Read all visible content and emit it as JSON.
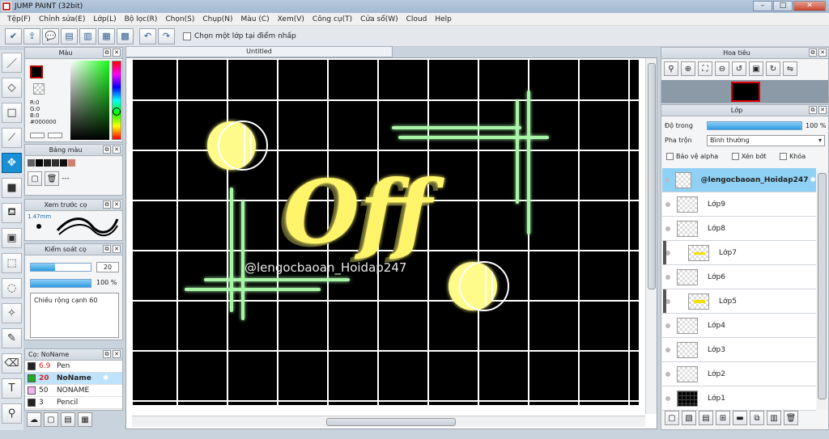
{
  "window": {
    "title": "JUMP PAINT (32bit)"
  },
  "menu": [
    "Tệp(F)",
    "Chỉnh sửa(E)",
    "Lớp(L)",
    "Bộ lọc(R)",
    "Chọn(S)",
    "Chụp(N)",
    "Màu (C)",
    "Xem(V)",
    "Công cụ(T)",
    "Cửa sổ(W)",
    "Cloud",
    "Help"
  ],
  "toolbar": {
    "select_layer_label": "Chọn một lớp tại điểm nhấp"
  },
  "color_panel": {
    "title": "Màu",
    "r": "R:0",
    "g": "G:0",
    "b": "B:0",
    "hex": "#000000",
    "fg_color": "#000000"
  },
  "palette_panel": {
    "title": "Bảng màu",
    "empty_label": "---",
    "swatches": [
      "#606060",
      "#000000",
      "#202020",
      "#303030",
      "#101010",
      "#d08070"
    ]
  },
  "preview_panel": {
    "title": "Xem trước cọ",
    "size": "1.47mm"
  },
  "brush_control": {
    "title": "Kiểm soát cọ",
    "size_value": "20",
    "opacity_value": "100 %",
    "width_label": "Chiều rộng cạnh",
    "width_value": "60"
  },
  "brush_list": {
    "title": "Cọ: NoName",
    "items": [
      {
        "size": "6.9",
        "name": "Pen",
        "color": "#222222"
      },
      {
        "size": "20",
        "name": "NoName",
        "color": "#22aa22"
      },
      {
        "size": "50",
        "name": "NONAME",
        "color": "#f4b4f4"
      },
      {
        "size": "3",
        "name": "Pencil",
        "color": "#222222"
      }
    ]
  },
  "document": {
    "tab_title": "Untitled",
    "watermark": "@lengocbaoan_Hoidap247",
    "text_art": "Off"
  },
  "navigator": {
    "title": "Hoa tiêu"
  },
  "layers": {
    "title": "Lớp",
    "opacity_label": "Độ trong",
    "opacity_value": "100 %",
    "blend_label": "Pha trộn",
    "blend_value": "Bình thường",
    "protect_alpha": "Bảo vệ alpha",
    "clip": "Xén bớt",
    "lock": "Khóa",
    "items": [
      {
        "name": "@lengocbaoan_Hoidap247",
        "selected": true
      },
      {
        "name": "Lớp9"
      },
      {
        "name": "Lớp8"
      },
      {
        "name": "Lớp7",
        "child": true
      },
      {
        "name": "Lớp6"
      },
      {
        "name": "Lớp5",
        "child": true
      },
      {
        "name": "Lớp4"
      },
      {
        "name": "Lớp3"
      },
      {
        "name": "Lớp2"
      },
      {
        "name": "Lớp1"
      }
    ]
  }
}
